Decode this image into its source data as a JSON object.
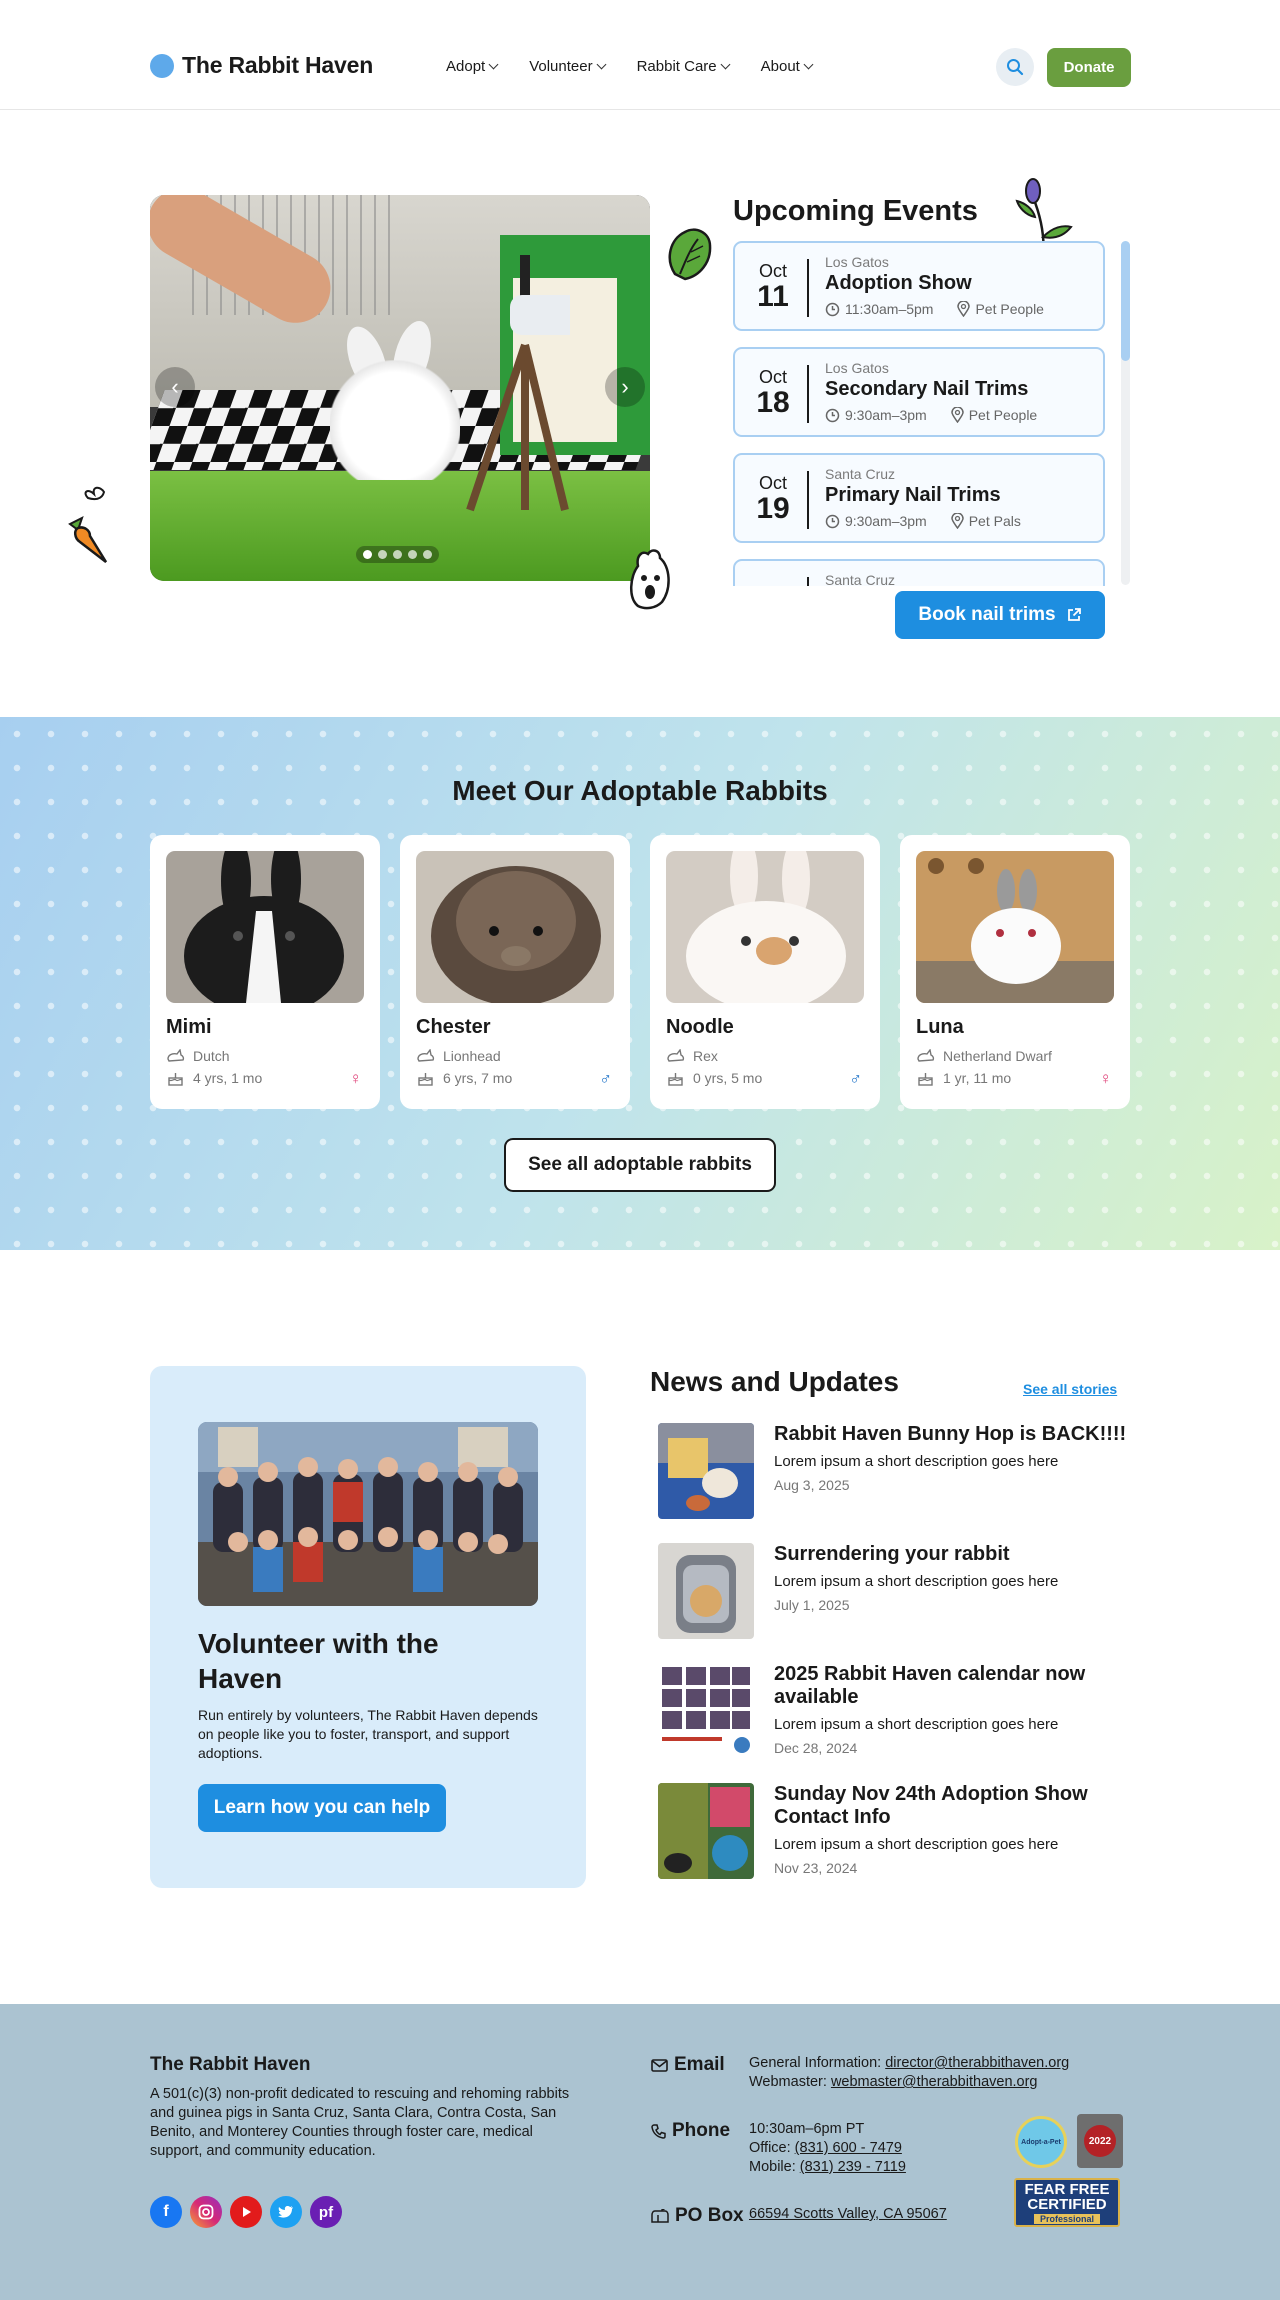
{
  "header": {
    "logo_text": "The Rabbit Haven",
    "nav": [
      "Adopt",
      "Volunteer",
      "Rabbit Care",
      "About"
    ],
    "donate_label": "Donate",
    "accent": "#5ea9ea",
    "donate_color": "#6a9e3f"
  },
  "hero": {
    "carousel_dots": 5,
    "events_title": "Upcoming Events",
    "events": [
      {
        "month": "Oct",
        "day": "11",
        "city": "Los Gatos",
        "name": "Adoption Show",
        "time": "11:30am–5pm",
        "place": "Pet People"
      },
      {
        "month": "Oct",
        "day": "18",
        "city": "Los Gatos",
        "name": "Secondary Nail Trims",
        "time": "9:30am–3pm",
        "place": "Pet People"
      },
      {
        "month": "Oct",
        "day": "19",
        "city": "Santa Cruz",
        "name": "Primary Nail Trims",
        "time": "9:30am–3pm",
        "place": "Pet Pals"
      },
      {
        "month": "",
        "day": "",
        "city": "Santa Cruz",
        "name": "",
        "time": "",
        "place": ""
      }
    ],
    "book_label": "Book nail trims"
  },
  "adopt": {
    "title": "Meet Our Adoptable Rabbits",
    "rabbits": [
      {
        "name": "Mimi",
        "breed": "Dutch",
        "age": "4 yrs, 1 mo",
        "gender": "♀",
        "gender_color": "#e0457b"
      },
      {
        "name": "Chester",
        "breed": "Lionhead",
        "age": "6 yrs, 7 mo",
        "gender": "♂",
        "gender_color": "#1e73c8"
      },
      {
        "name": "Noodle",
        "breed": "Rex",
        "age": "0 yrs, 5 mo",
        "gender": "♂",
        "gender_color": "#1e73c8"
      },
      {
        "name": "Luna",
        "breed": "Netherland Dwarf",
        "age": "1 yr, 11 mo",
        "gender": "♀",
        "gender_color": "#e0457b"
      }
    ],
    "see_all_label": "See all adoptable rabbits"
  },
  "volunteer": {
    "title": "Volunteer with the Haven",
    "text": "Run entirely by volunteers, The Rabbit Haven depends on people like you to foster, transport, and support adoptions.",
    "button": "Learn how you can help"
  },
  "news": {
    "title": "News and Updates",
    "see_all": "See all stories",
    "items": [
      {
        "title": "Rabbit Haven Bunny Hop is BACK!!!!",
        "desc": "Lorem ipsum a short description goes here",
        "date": "Aug 3, 2025"
      },
      {
        "title": "Surrendering your rabbit",
        "desc": "Lorem ipsum a short description goes here",
        "date": "July 1, 2025"
      },
      {
        "title": "2025 Rabbit Haven calendar now available",
        "desc": "Lorem ipsum a short description goes here",
        "date": "Dec 28, 2024"
      },
      {
        "title": "Sunday Nov 24th Adoption Show Contact Info",
        "desc": "Lorem ipsum a short description goes here",
        "date": "Nov 23, 2024"
      }
    ]
  },
  "footer": {
    "org": "The Rabbit Haven",
    "desc": "A 501(c)(3) non-profit dedicated to rescuing and rehoming rabbits and guinea pigs in Santa Cruz, Santa Clara, Contra Costa, San Benito, and Monterey Counties through foster care, medical support, and community education.",
    "email_label": "Email",
    "email_general_prefix": "General Information: ",
    "email_general": "director@therabbithaven.org",
    "email_web_prefix": "Webmaster: ",
    "email_web": "webmaster@therabbithaven.org",
    "phone_label": "Phone",
    "hours": "10:30am–6pm PT",
    "office_prefix": "Office: ",
    "office": "(831) 600 - 7479",
    "mobile_prefix": "Mobile: ",
    "mobile": "(831) 239 - 7119",
    "pobox_label": "PO Box",
    "pobox": "66594 Scotts Valley, CA 95067",
    "badge_adopt": "Adopt-a-Pet",
    "badge_year": "2022",
    "badge_fearfree_1": "FEAR FREE",
    "badge_fearfree_2": "CERTIFIED",
    "badge_fearfree_3": "Professional",
    "bg": "#abc3d1"
  }
}
